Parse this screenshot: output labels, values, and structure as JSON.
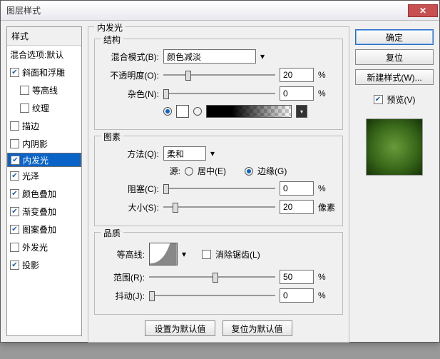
{
  "title": "图层样式",
  "left": {
    "header": "样式",
    "blend_opts": "混合选项:默认",
    "items": [
      {
        "label": "斜面和浮雕",
        "checked": true,
        "sub": false
      },
      {
        "label": "等高线",
        "checked": false,
        "sub": true
      },
      {
        "label": "纹理",
        "checked": false,
        "sub": true
      },
      {
        "label": "描边",
        "checked": false,
        "sub": false
      },
      {
        "label": "内阴影",
        "checked": false,
        "sub": false
      },
      {
        "label": "内发光",
        "checked": true,
        "sub": false,
        "selected": true
      },
      {
        "label": "光泽",
        "checked": true,
        "sub": false
      },
      {
        "label": "颜色叠加",
        "checked": true,
        "sub": false
      },
      {
        "label": "渐变叠加",
        "checked": true,
        "sub": false
      },
      {
        "label": "图案叠加",
        "checked": true,
        "sub": false
      },
      {
        "label": "外发光",
        "checked": false,
        "sub": false
      },
      {
        "label": "投影",
        "checked": true,
        "sub": false
      }
    ]
  },
  "panel": {
    "title": "内发光",
    "structure": {
      "title": "结构",
      "blend_mode_label": "混合模式(B):",
      "blend_mode_value": "颜色减淡",
      "opacity_label": "不透明度(O):",
      "opacity_value": "20",
      "opacity_unit": "%",
      "noise_label": "杂色(N):",
      "noise_value": "0",
      "noise_unit": "%",
      "color_swatch": "#ffffff"
    },
    "elements": {
      "title": "图素",
      "technique_label": "方法(Q):",
      "technique_value": "柔和",
      "source_label": "源:",
      "source_center": "居中(E)",
      "source_edge": "边缘(G)",
      "source_selected": "edge",
      "choke_label": "阻塞(C):",
      "choke_value": "0",
      "choke_unit": "%",
      "size_label": "大小(S):",
      "size_value": "20",
      "size_unit": "像素"
    },
    "quality": {
      "title": "品质",
      "contour_label": "等高线:",
      "antialias_label": "消除锯齿(L)",
      "range_label": "范围(R):",
      "range_value": "50",
      "range_unit": "%",
      "jitter_label": "抖动(J):",
      "jitter_value": "0",
      "jitter_unit": "%"
    },
    "buttons": {
      "make_default": "设置为默认值",
      "reset_default": "复位为默认值"
    }
  },
  "right": {
    "ok": "确定",
    "cancel": "复位",
    "new_style": "新建样式(W)...",
    "preview_label": "预览(V)"
  }
}
